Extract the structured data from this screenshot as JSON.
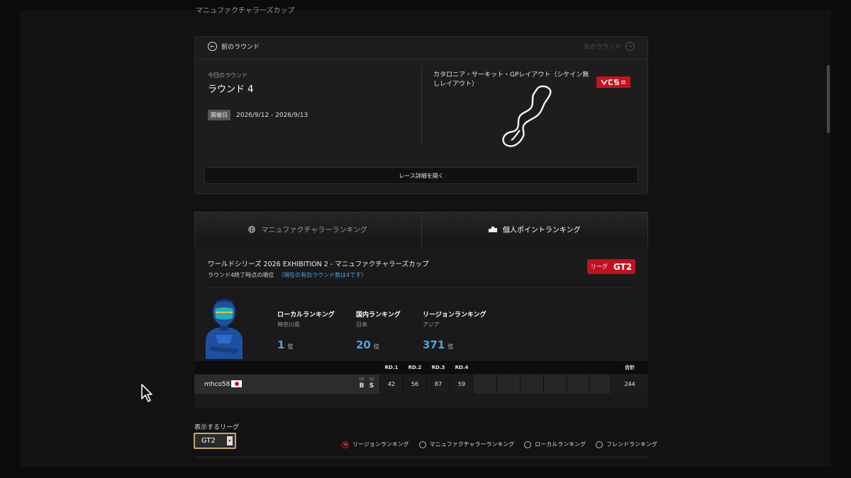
{
  "header": {
    "crumb": "マニュファクチャラーズカップ"
  },
  "round_nav": {
    "prev_label": "前のラウンド",
    "next_label": "次のラウンド"
  },
  "round": {
    "caption": "今回のラウンド",
    "title": "ラウンド 4",
    "date_badge": "開催日",
    "date_range": "2026/9/12 - 2026/9/13",
    "track_name": "カタロニア・サーキット・GPレイアウト（シケイン無しレイアウト）",
    "details_button": "レース詳細を開く"
  },
  "tabs": [
    {
      "label": "マニュファクチャラーランキング",
      "icon": "globe-icon",
      "active": false
    },
    {
      "label": "個人ポイントランキング",
      "icon": "podium-icon",
      "active": true
    }
  ],
  "ranking": {
    "series_title": "ワールドシリーズ 2026 EXHIBITION 2 - マニュファクチャラーズカップ",
    "subtitle": "ラウンド4終了時点の順位",
    "subtitle_note": "（現在の有効ラウンド数は4です）",
    "league_label": "リーグ",
    "league_value": "GT2",
    "blocks": [
      {
        "label": "ローカルランキング",
        "area": "神奈川県",
        "value": "1",
        "unit": "位"
      },
      {
        "label": "国内ランキング",
        "area": "日本",
        "value": "20",
        "unit": "位"
      },
      {
        "label": "リージョンランキング",
        "area": "アジア",
        "value": "371",
        "unit": "位"
      }
    ]
  },
  "table": {
    "headers": [
      "RD.1",
      "RD.2",
      "RD.3",
      "RD.4"
    ],
    "total_header": "合計",
    "row": {
      "player": "mhco58",
      "dr_label": "DR",
      "dr_value": "B",
      "sr_label": "SR",
      "sr_value": "S",
      "scores": [
        "42",
        "56",
        "87",
        "59"
      ],
      "total": "244"
    }
  },
  "controls": {
    "league_select_label": "表示するリーグ",
    "league_select_value": "GT2",
    "radio_options": [
      "リージョンランキング",
      "マニュファクチャラーランキング",
      "ローカルランキング",
      "フレンドランキング"
    ],
    "radio_selected_index": 0
  },
  "colors": {
    "accent_red": "#c0111f",
    "rank_blue": "#4ba4e6"
  }
}
